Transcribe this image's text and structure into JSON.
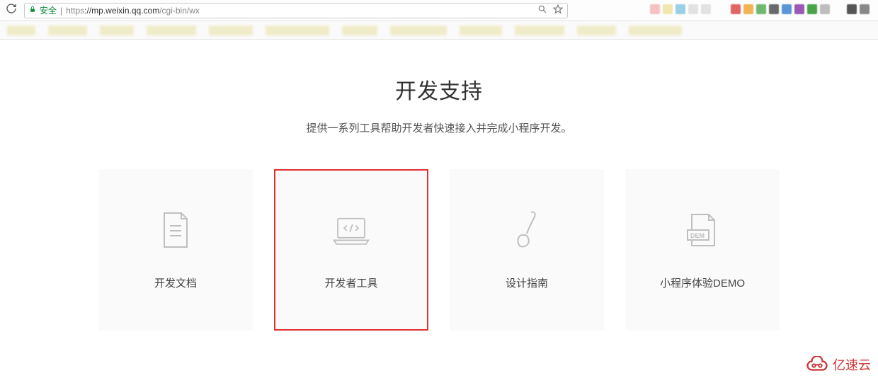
{
  "browser": {
    "secure_label": "安全",
    "url_protocol": "https",
    "url_host": "://mp.weixin.qq.com",
    "url_path": "/cgi-bin/wx",
    "zoom_icon_title": "zoom",
    "star_icon_title": "bookmark"
  },
  "bookmark_colors": [
    "#e8e4c4",
    "#e8e4c4",
    "#e8e4c4",
    "#e8e4c4",
    "#e8e4c4",
    "#e8e4c4",
    "#e8e4c4",
    "#e8e4c4",
    "#e8e4c4",
    "#e8e4c4",
    "#e8e4c4",
    "#e8e4c4"
  ],
  "ext_colors": [
    "#f4c2c2",
    "#f1e5b0",
    "#9acfe8",
    "#6fb870",
    "#9b6bd6",
    "#a9d3ec",
    "#e06666",
    "#f0b455",
    "#7bc37b",
    "#5a95d6",
    "#6a6a6a",
    "#bdbdbd",
    "#9b59b6",
    "#555555"
  ],
  "page": {
    "title": "开发支持",
    "subtitle": "提供一系列工具帮助开发者快速接入并完成小程序开发。"
  },
  "cards": [
    {
      "label": "开发文档",
      "icon": "document-icon",
      "highlighted": false
    },
    {
      "label": "开发者工具",
      "icon": "laptop-code-icon",
      "highlighted": true
    },
    {
      "label": "设计指南",
      "icon": "brush-icon",
      "highlighted": false
    },
    {
      "label": "小程序体验DEMO",
      "icon": "demo-icon",
      "highlighted": false
    }
  ],
  "watermark": {
    "text": "亿速云"
  }
}
